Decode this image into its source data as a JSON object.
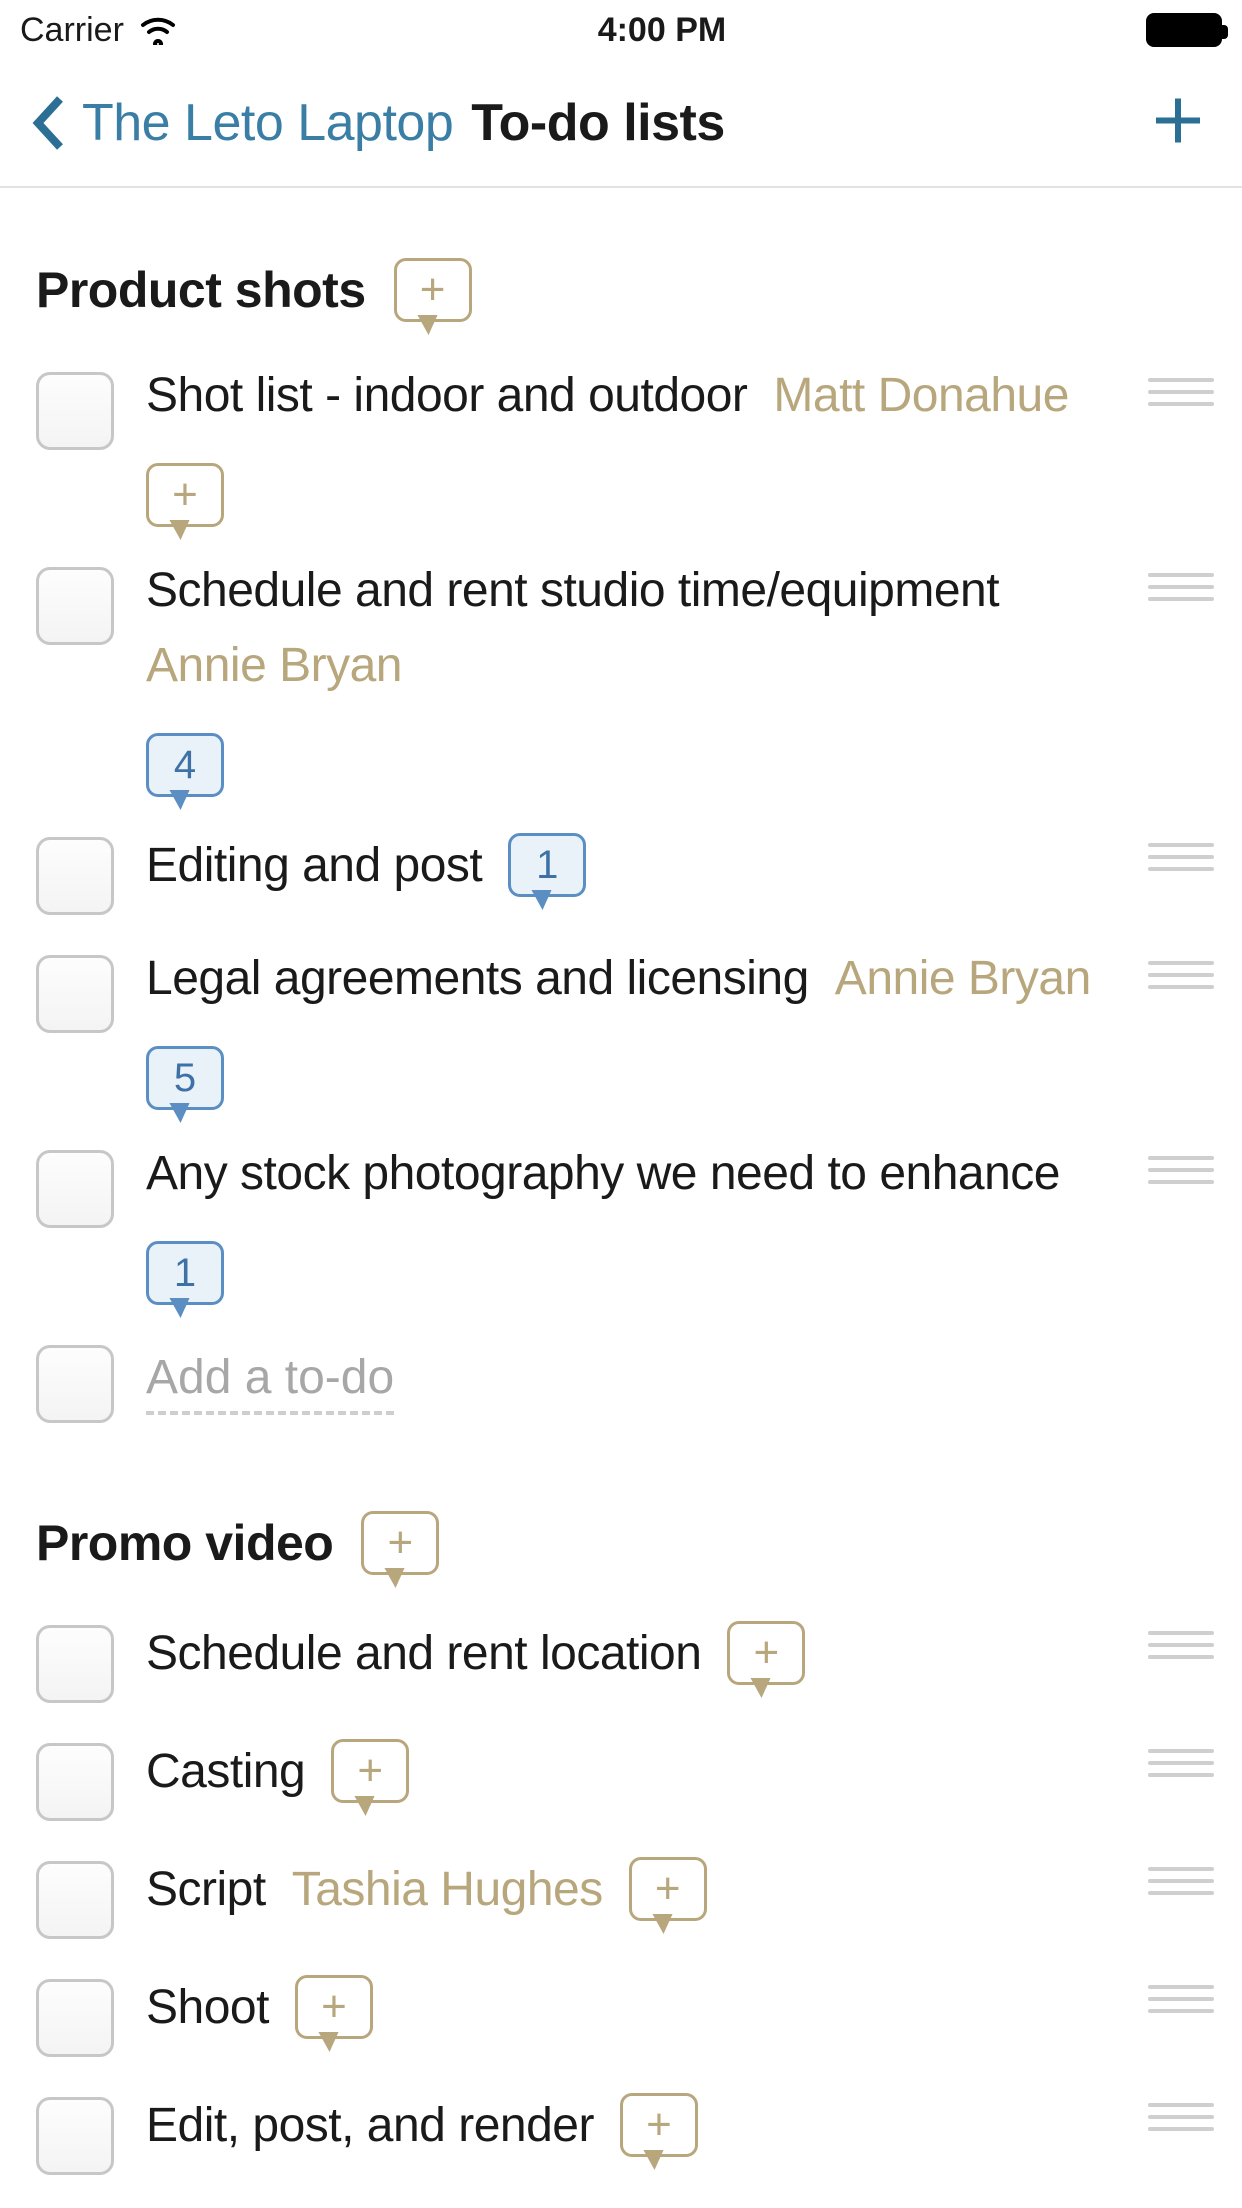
{
  "status": {
    "carrier": "Carrier",
    "time": "4:00 PM"
  },
  "nav": {
    "back_label": "The Leto Laptop",
    "title": "To-do lists"
  },
  "add_todo_placeholder": "Add a to-do",
  "lists": [
    {
      "title": "Product shots",
      "todos": [
        {
          "title": "Shot list - indoor and outdoor",
          "assignee": "Matt Donahue",
          "comments_count": null,
          "empty_bubble": true
        },
        {
          "title": "Schedule and rent studio time/equipment",
          "assignee": "Annie Bryan",
          "comments_count": 4,
          "empty_bubble": false
        },
        {
          "title": "Editing and post",
          "assignee": null,
          "comments_count": 1,
          "empty_bubble": false
        },
        {
          "title": "Legal agreements and licensing",
          "assignee": "Annie Bryan",
          "comments_count": 5,
          "empty_bubble": false
        },
        {
          "title": "Any stock photography we need to enhance",
          "assignee": null,
          "comments_count": 1,
          "empty_bubble": false
        }
      ],
      "show_add": true
    },
    {
      "title": "Promo video",
      "todos": [
        {
          "title": "Schedule and rent location",
          "assignee": null,
          "comments_count": null,
          "empty_bubble": true
        },
        {
          "title": "Casting",
          "assignee": null,
          "comments_count": null,
          "empty_bubble": true
        },
        {
          "title": "Script",
          "assignee": "Tashia Hughes",
          "comments_count": null,
          "empty_bubble": true
        },
        {
          "title": "Shoot",
          "assignee": null,
          "comments_count": null,
          "empty_bubble": true
        },
        {
          "title": "Edit, post, and render",
          "assignee": null,
          "comments_count": null,
          "empty_bubble": true
        }
      ],
      "show_add": false
    }
  ]
}
